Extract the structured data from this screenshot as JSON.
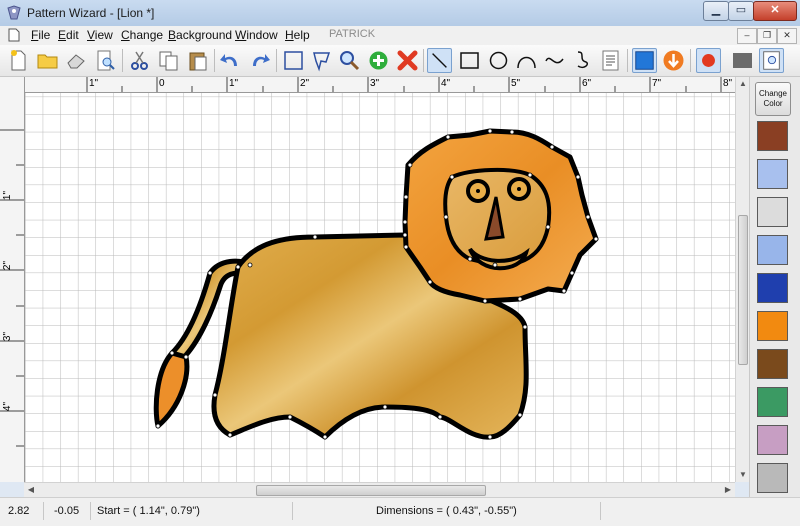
{
  "window": {
    "title": "Pattern Wizard - [Lion *]"
  },
  "menu": {
    "items": [
      {
        "key": "F",
        "rest": "ile"
      },
      {
        "key": "E",
        "rest": "dit"
      },
      {
        "key": "V",
        "rest": "iew"
      },
      {
        "key": "C",
        "rest": "hange"
      },
      {
        "key": "B",
        "rest": "ackground"
      },
      {
        "key": "W",
        "rest": "indow"
      },
      {
        "key": "H",
        "rest": "elp"
      }
    ],
    "user": "PATRICK"
  },
  "toolbar": {
    "buttons": [
      "new",
      "open",
      "erase",
      "print-preview",
      "cut",
      "copy",
      "paste",
      "undo",
      "redo",
      "select-rectangle",
      "select-lasso",
      "zoom",
      "add",
      "delete",
      "draw-line",
      "draw-rectangle",
      "draw-circle",
      "draw-arc",
      "draw-curve",
      "draw-freehand",
      "text",
      "fill-color",
      "send-back",
      "record",
      "background-color",
      "zoom-fit"
    ]
  },
  "ruler": {
    "h_labels": [
      "1\"",
      "0",
      "1\"",
      "2\"",
      "3\"",
      "4\"",
      "5\"",
      "6\"",
      "7\"",
      "8\""
    ],
    "v_labels": [
      "1\"",
      "2\"",
      "3\"",
      "4\""
    ]
  },
  "palette": {
    "change_color_label": "Change Color",
    "swatches": [
      "#8a3f23",
      "#a8c0ee",
      "#dcdcdc",
      "#98b5ea",
      "#1f3fae",
      "#f28a10",
      "#7a4a1c",
      "#3b9a63",
      "#c79ec3",
      "#b9b9b9"
    ]
  },
  "status": {
    "x": "2.82",
    "y": "-0.05",
    "start": "Start = ( 1.14\",  0.79\")",
    "dimensions": "Dimensions = ( 0.43\", -0.55\")"
  }
}
